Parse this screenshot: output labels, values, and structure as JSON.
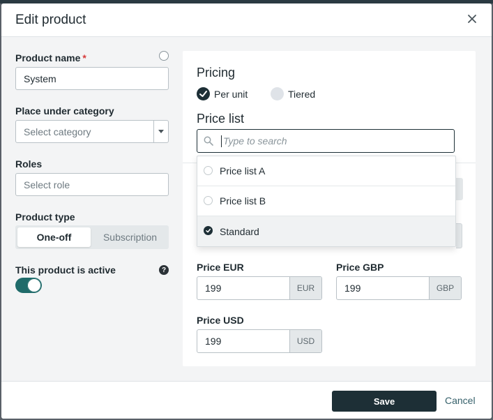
{
  "modal": {
    "title": "Edit product"
  },
  "left": {
    "product_name": {
      "label": "Product name",
      "required_mark": "*",
      "value": "System"
    },
    "category": {
      "label": "Place under category",
      "placeholder": "Select category"
    },
    "roles": {
      "label": "Roles",
      "placeholder": "Select role"
    },
    "product_type": {
      "label": "Product type",
      "options": [
        "One-off",
        "Subscription"
      ],
      "selected": "One-off"
    },
    "active": {
      "label": "This product is active",
      "help_icon": "?",
      "toggle_on": true
    }
  },
  "pricing": {
    "title": "Pricing",
    "options": [
      {
        "label": "Per unit",
        "checked": true
      },
      {
        "label": "Tiered",
        "checked": false
      }
    ],
    "price_list": {
      "title": "Price list",
      "search_placeholder": "Type to search",
      "items": [
        {
          "label": "Price list A",
          "selected": false
        },
        {
          "label": "Price list B",
          "selected": false
        },
        {
          "label": "Standard",
          "selected": true
        }
      ]
    },
    "prices": [
      {
        "label": "Price EUR",
        "value": "199",
        "currency": "EUR"
      },
      {
        "label": "Price GBP",
        "value": "199",
        "currency": "GBP"
      },
      {
        "label": "Price USD",
        "value": "199",
        "currency": "USD"
      }
    ]
  },
  "footer": {
    "save_label": "Save",
    "cancel_label": "Cancel"
  },
  "colors": {
    "primary": "#1d2f36",
    "toggle": "#1f6b6a",
    "required": "#d63b3b",
    "link": "#35606a"
  }
}
